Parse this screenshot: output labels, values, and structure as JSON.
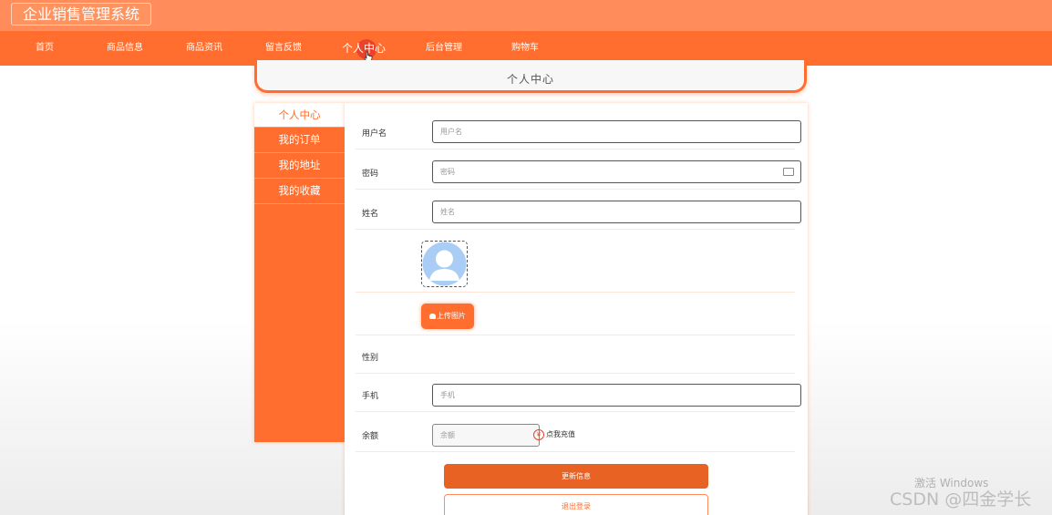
{
  "app": {
    "title": "企业销售管理系统"
  },
  "nav": {
    "items": [
      {
        "label": "首页"
      },
      {
        "label": "商品信息"
      },
      {
        "label": "商品资讯"
      },
      {
        "label": "留言反馈"
      },
      {
        "label": "个人中心"
      },
      {
        "label": "后台管理"
      },
      {
        "label": "购物车"
      }
    ],
    "active": "个人中心"
  },
  "page": {
    "title": "个人中心"
  },
  "sidebar": {
    "items": [
      {
        "label": "个人中心"
      },
      {
        "label": "我的订单"
      },
      {
        "label": "我的地址"
      },
      {
        "label": "我的收藏"
      }
    ]
  },
  "form": {
    "username": {
      "label": "用户名",
      "placeholder": "用户名"
    },
    "password": {
      "label": "密码",
      "placeholder": "密码"
    },
    "name": {
      "label": "姓名",
      "placeholder": "姓名"
    },
    "upload_label": "上传图片",
    "gender": {
      "label": "性别"
    },
    "phone": {
      "label": "手机",
      "placeholder": "手机"
    },
    "balance": {
      "label": "余额",
      "placeholder": "余额"
    },
    "recharge_label": "点我充值",
    "update_button": "更新信息",
    "logout_button": "退出登录"
  },
  "watermark": {
    "activate": "激活 Windows",
    "credit": "CSDN @四金学长"
  },
  "colors": {
    "topbar": "#ff8c5a",
    "nav": "#ff6e2e",
    "accent": "#e86224"
  }
}
